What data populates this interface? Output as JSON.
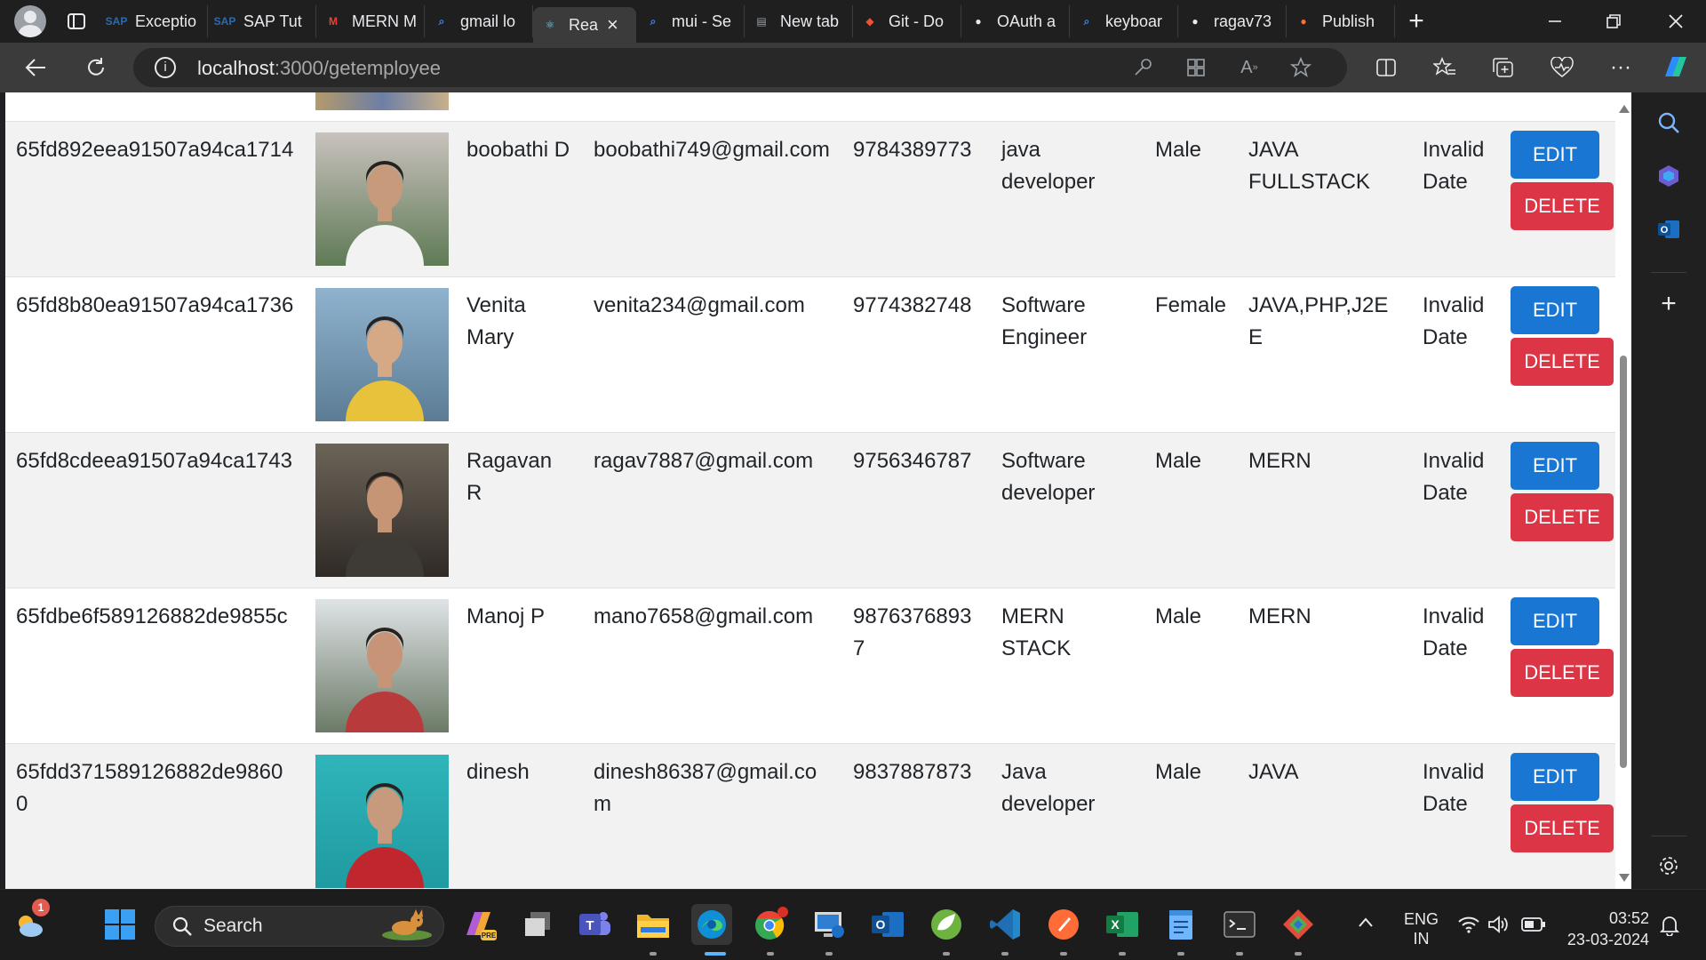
{
  "browser": {
    "tabs": [
      {
        "label": "Exceptio",
        "icon": "sap-icon",
        "fav_color": "#2b6cb0",
        "fav_text": "SAP"
      },
      {
        "label": "SAP Tut",
        "icon": "sap-icon",
        "fav_color": "#2b6cb0",
        "fav_text": "SAP"
      },
      {
        "label": "MERN M",
        "icon": "gmail-icon",
        "fav_color": "#ea4335",
        "fav_text": "M"
      },
      {
        "label": "gmail lo",
        "icon": "search-icon",
        "fav_color": "#3b82f6",
        "fav_text": "⌕"
      },
      {
        "label": "Rea",
        "icon": "react-icon",
        "fav_color": "#61dafb",
        "fav_text": "⚛",
        "active": true
      },
      {
        "label": "mui - Se",
        "icon": "search-icon",
        "fav_color": "#3b82f6",
        "fav_text": "⌕"
      },
      {
        "label": "New tab",
        "icon": "newtab-icon",
        "fav_color": "#9aa0a6",
        "fav_text": "▤"
      },
      {
        "label": "Git - Do",
        "icon": "git-icon",
        "fav_color": "#f05133",
        "fav_text": "◆"
      },
      {
        "label": "OAuth a",
        "icon": "github-icon",
        "fav_color": "#e8eaed",
        "fav_text": "●"
      },
      {
        "label": "keyboar",
        "icon": "search-icon",
        "fav_color": "#3b82f6",
        "fav_text": "⌕"
      },
      {
        "label": "ragav73",
        "icon": "github-icon",
        "fav_color": "#e8eaed",
        "fav_text": "●"
      },
      {
        "label": "Publish",
        "icon": "postman-icon",
        "fav_color": "#ff6c37",
        "fav_text": "●"
      }
    ],
    "url_host": "localhost",
    "url_path": ":3000/getemployee"
  },
  "employees": [
    {
      "id": "65fd892eea91507a94ca1714",
      "name": "boobathi D",
      "email": "boobathi749@gmail.com",
      "phone": "9784389773",
      "designation": "java developer",
      "gender": "Male",
      "course": "JAVA FULLSTACK",
      "date": "Invalid Date",
      "photo_top": "#c9c2bd",
      "photo_bottom": "#5f7a55",
      "skin": "#c89a7c",
      "shirt": "#f2f2f2"
    },
    {
      "id": "65fd8b80ea91507a94ca1736",
      "name": "Venita Mary",
      "email": "venita234@gmail.com",
      "phone": "9774382748",
      "designation": "Software Engineer",
      "gender": "Female",
      "course": "JAVA,PHP,J2EE",
      "date": "Invalid Date",
      "photo_top": "#8fb3cf",
      "photo_bottom": "#5c7c94",
      "skin": "#d6a986",
      "shirt": "#e7c23a"
    },
    {
      "id": "65fd8cdeea91507a94ca1743",
      "name": "Ragavan R",
      "email": "ragav7887@gmail.com",
      "phone": "9756346787",
      "designation": "Software developer",
      "gender": "Male",
      "course": "MERN",
      "date": "Invalid Date",
      "photo_top": "#6b6458",
      "photo_bottom": "#2f2a26",
      "skin": "#c69575",
      "shirt": "#3e3a36"
    },
    {
      "id": "65fdbe6f589126882de9855c",
      "name": "Manoj P",
      "email": "mano7658@gmail.com",
      "phone": "98763768937",
      "designation": "MERN STACK",
      "gender": "Male",
      "course": "MERN",
      "date": "Invalid Date",
      "photo_top": "#dfe3e6",
      "photo_bottom": "#6b7a66",
      "skin": "#c79477",
      "shirt": "#b83a3a"
    },
    {
      "id": "65fdd371589126882de98600",
      "name": "dinesh",
      "email": "dinesh86387@gmail.com",
      "phone": "9837887873",
      "designation": "Java developer",
      "gender": "Male",
      "course": "JAVA",
      "date": "Invalid Date",
      "photo_top": "#2fb5ba",
      "photo_bottom": "#1f9aa0",
      "skin": "#c79a7e",
      "shirt": "#c0262d"
    }
  ],
  "actions": {
    "edit": "EDIT",
    "delete": "DELETE"
  },
  "colors": {
    "edit": "#1976d2",
    "delete": "#dc3545",
    "row_alt": "#f2f2f2"
  },
  "taskbar": {
    "search_label": "Search",
    "weather_badge": "1",
    "lang_line1": "ENG",
    "lang_line2": "IN",
    "time": "03:52",
    "date": "23-03-2024"
  }
}
